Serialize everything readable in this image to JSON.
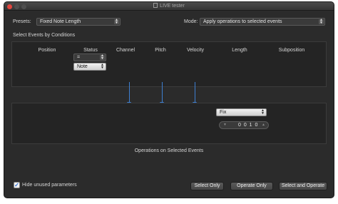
{
  "window": {
    "title": "LIVE tester"
  },
  "presets": {
    "label": "Presets:",
    "value": "Fixed Note Length"
  },
  "mode": {
    "label": "Mode:",
    "value": "Apply operations to selected events"
  },
  "conditions": {
    "heading": "Select Events by Conditions",
    "columns": [
      "Position",
      "Status",
      "Channel",
      "Pitch",
      "Velocity",
      "Length",
      "Subposition"
    ],
    "status_operator": "=",
    "status_value": "Note"
  },
  "operations": {
    "heading": "Operations on Selected Events",
    "length_operator": "Fix",
    "length_value": "0 0 1   0"
  },
  "footer": {
    "hide_unused_label": "Hide unused parameters",
    "hide_unused_checked": true,
    "buttons": [
      "Select Only",
      "Operate Only",
      "Select and Operate"
    ]
  },
  "colors": {
    "accent": "#3d7fd1",
    "window_bg": "#2b2b2b",
    "panel_bg": "#242424",
    "close": "#e2463f"
  }
}
